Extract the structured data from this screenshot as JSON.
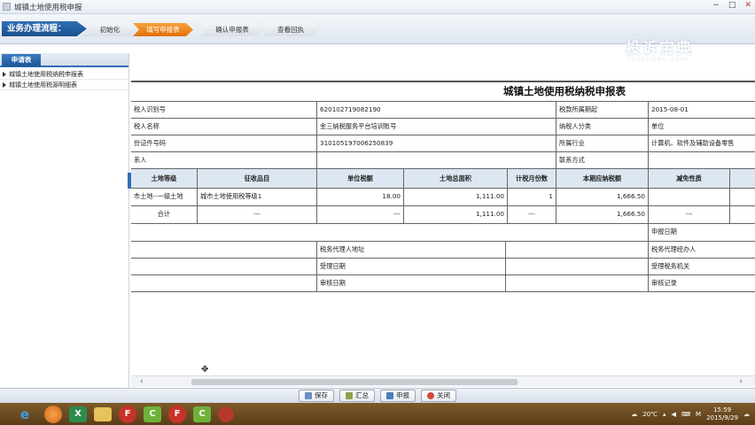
{
  "window": {
    "title": "城镇土地使用税申报"
  },
  "flow": {
    "label": "业务办理流程：",
    "steps": [
      {
        "label": "初始化",
        "active": false
      },
      {
        "label": "填写申报表",
        "active": true
      },
      {
        "label": "确认申报表",
        "active": false
      },
      {
        "label": "查看回执",
        "active": false
      }
    ]
  },
  "watermark": {
    "text": "投诉宝典",
    "sub": "tousubao.com"
  },
  "sidebar": {
    "tab": "申请表",
    "items": [
      "城镇土地使用税纳税申报表",
      "城镇土地使用税源明细表"
    ]
  },
  "form": {
    "title": "城镇土地使用税纳税申报表",
    "info_rows": [
      [
        "税人识别号",
        "620102719082190",
        "税款所属期起",
        "2015-08-01"
      ],
      [
        "税人名称",
        "金三纳税服务平台培训账号",
        "纳税人分类",
        "单位"
      ],
      [
        "份证件号码",
        "310105197006250839",
        "所属行业",
        "计算机、软件及辅助设备零售"
      ],
      [
        "系人",
        "",
        "联系方式",
        ""
      ]
    ],
    "table_headers": [
      "土地等级",
      "征收品目",
      "单位税额",
      "土地总面积",
      "计税月份数",
      "本期应纳税额",
      "减免性质",
      ""
    ],
    "table_rows": [
      [
        "市土地--一级土地",
        "城市土地使用税等级1",
        "18.00",
        "1,111.00",
        "1",
        "1,666.50",
        "",
        ""
      ],
      [
        "合计",
        "---",
        "---",
        "1,111.00",
        "---",
        "1,666.50",
        "---",
        ""
      ]
    ],
    "footer_rows": [
      [
        "",
        "",
        "",
        "申报日期"
      ],
      [
        "",
        "税务代理人地址",
        "",
        "税务代理经办人"
      ],
      [
        "",
        "受理日期",
        "",
        "受理税务机关"
      ],
      [
        "",
        "审核日期",
        "",
        "审核记录"
      ]
    ]
  },
  "actions": {
    "save": "保存",
    "summary": "汇总",
    "declare": "申报",
    "close": "关闭"
  },
  "taskbar": {
    "temperature": "20℃",
    "time": "15:59",
    "date": "2015/9/29",
    "tray_letter": "M"
  },
  "colors": {
    "accent": "#2f6fb6",
    "active_step": "#e36f0a"
  }
}
